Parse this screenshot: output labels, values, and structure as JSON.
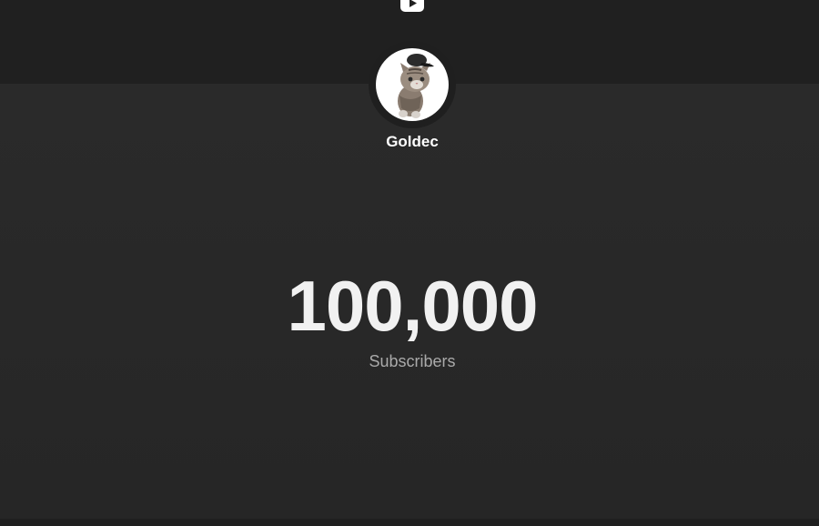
{
  "channel": {
    "name": "Goldec",
    "avatar": "cat-with-cap-avatar"
  },
  "stats": {
    "subscriber_count": "100,000",
    "subscriber_label": "Subscribers"
  },
  "icons": {
    "logo": "youtube-play-icon"
  },
  "colors": {
    "background": "#272727",
    "header": "#202020",
    "text_primary": "#ffffff",
    "text_secondary": "#aaaaaa"
  }
}
